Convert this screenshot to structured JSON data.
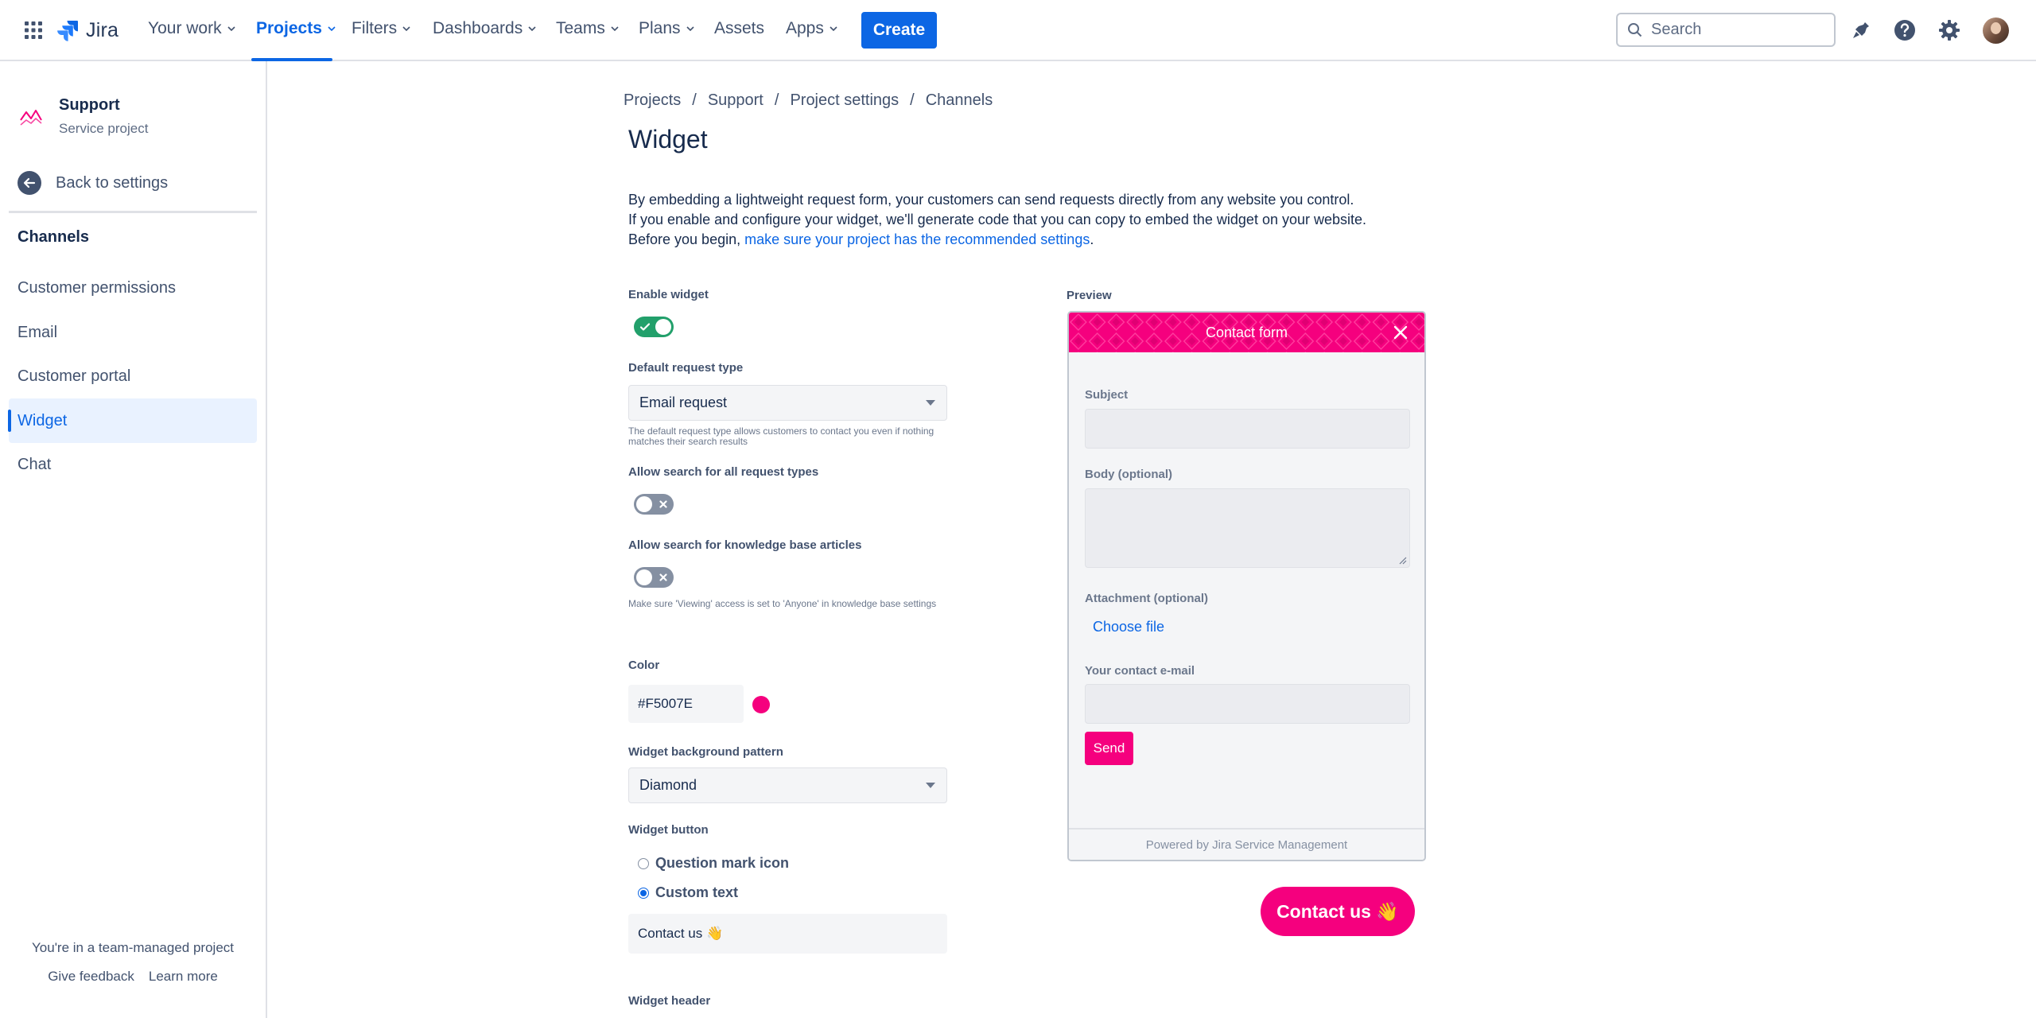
{
  "topnav": {
    "logo_text": "Jira",
    "items": [
      {
        "label": "Your work"
      },
      {
        "label": "Projects"
      },
      {
        "label": "Filters"
      },
      {
        "label": "Dashboards"
      },
      {
        "label": "Teams"
      },
      {
        "label": "Plans"
      },
      {
        "label": "Assets"
      },
      {
        "label": "Apps"
      }
    ],
    "active_item": "Projects",
    "create_label": "Create",
    "search_placeholder": "Search",
    "icons": [
      "app-switcher-icon",
      "jira-logo-icon",
      "notifications-icon",
      "help-icon",
      "settings-icon",
      "avatar"
    ]
  },
  "sidebar": {
    "project_name": "Support",
    "project_type": "Service project",
    "back_label": "Back to settings",
    "section_title": "Channels",
    "items": [
      {
        "label": "Customer permissions"
      },
      {
        "label": "Email"
      },
      {
        "label": "Customer portal"
      },
      {
        "label": "Widget"
      },
      {
        "label": "Chat"
      }
    ],
    "active_item": "Widget",
    "footer_text": "You're in a team-managed project",
    "feedback_label": "Give feedback",
    "learn_more_label": "Learn more"
  },
  "breadcrumb": [
    "Projects",
    "Support",
    "Project settings",
    "Channels"
  ],
  "breadcrumb_separator": "/",
  "page": {
    "title": "Widget",
    "desc_line1": "By embedding a lightweight request form, your customers can send requests directly from any website you control.",
    "desc_line2": "If you enable and configure your widget, we'll generate code that you can copy to embed the widget on your website.",
    "desc_line3_prefix": "Before you begin, ",
    "desc_link": "make sure your project has the recommended settings",
    "desc_line3_suffix": "."
  },
  "form": {
    "enable_widget_label": "Enable widget",
    "enable_widget_on": true,
    "default_request_type_label": "Default request type",
    "default_request_type_value": "Email request",
    "default_request_type_help": "The default request type allows customers to contact you even if nothing matches their search results",
    "allow_search_request_label": "Allow search for all request types",
    "allow_search_request_on": false,
    "allow_search_kb_label": "Allow search for knowledge base articles",
    "allow_search_kb_on": false,
    "allow_search_kb_help": "Make sure 'Viewing' access is set to 'Anyone' in knowledge base settings",
    "color_label": "Color",
    "color_value": "#F5007E",
    "pattern_label": "Widget background pattern",
    "pattern_value": "Diamond",
    "button_label": "Widget button",
    "button_options": [
      {
        "label": "Question mark icon",
        "checked": false
      },
      {
        "label": "Custom text",
        "checked": true
      }
    ],
    "custom_text_value": "Contact us 👋",
    "header_label": "Widget header"
  },
  "preview": {
    "label": "Preview",
    "header_title": "Contact form",
    "subject_label": "Subject",
    "body_label": "Body (optional)",
    "attachment_label": "Attachment (optional)",
    "choose_file_label": "Choose file",
    "email_label": "Your contact e-mail",
    "send_label": "Send",
    "footer_text": "Powered by Jira Service Management",
    "contact_button_text": "Contact us 👋"
  },
  "colors": {
    "brand_blue": "#0C66E4",
    "widget_pink": "#F5007E",
    "toggle_on": "#22A06B",
    "toggle_off": "#8590A2"
  }
}
